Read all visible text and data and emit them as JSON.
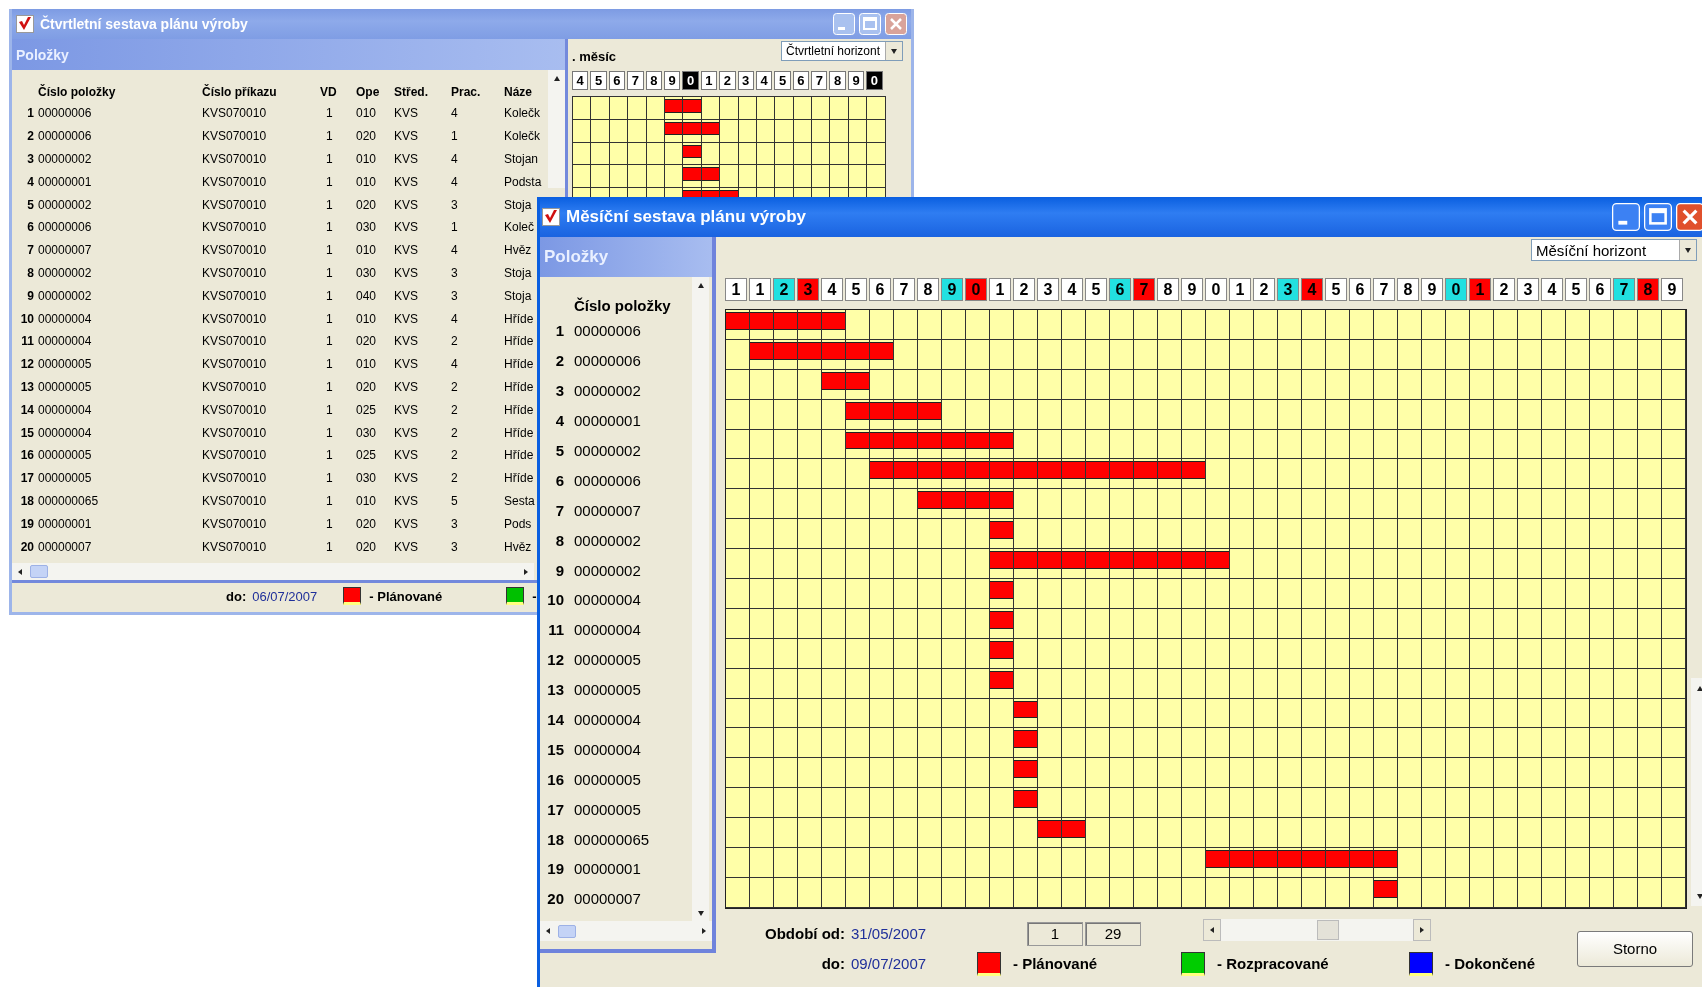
{
  "quarterly_window": {
    "title": "Čtvrtletní sestava plánu výroby",
    "active": false,
    "panel_title": "Položky",
    "columns": [
      "Číslo položky",
      "Číslo příkazu",
      "VD",
      "Ope",
      "Střed.",
      "Prac.",
      "Náze"
    ],
    "rows": [
      {
        "no": "1",
        "item": "00000006",
        "order": "KVS070010",
        "vd": "1",
        "op": "010",
        "center": "KVS",
        "workers": "4",
        "name": "Kolečk",
        "planned": [
          false,
          false,
          false,
          false,
          false,
          true,
          true,
          false,
          false,
          false,
          false,
          false,
          false,
          false,
          false,
          false,
          false
        ]
      },
      {
        "no": "2",
        "item": "00000006",
        "order": "KVS070010",
        "vd": "1",
        "op": "020",
        "center": "KVS",
        "workers": "1",
        "name": "Kolečk",
        "planned": [
          false,
          false,
          false,
          false,
          false,
          true,
          true,
          true,
          false,
          false,
          false,
          false,
          false,
          false,
          false,
          false,
          false
        ]
      },
      {
        "no": "3",
        "item": "00000002",
        "order": "KVS070010",
        "vd": "1",
        "op": "010",
        "center": "KVS",
        "workers": "4",
        "name": "Stojan",
        "planned": [
          false,
          false,
          false,
          false,
          false,
          false,
          true,
          false,
          false,
          false,
          false,
          false,
          false,
          false,
          false,
          false,
          false
        ]
      },
      {
        "no": "4",
        "item": "00000001",
        "order": "KVS070010",
        "vd": "1",
        "op": "010",
        "center": "KVS",
        "workers": "4",
        "name": "Podsta",
        "planned": [
          false,
          false,
          false,
          false,
          false,
          false,
          true,
          true,
          false,
          false,
          false,
          false,
          false,
          false,
          false,
          false,
          false
        ]
      },
      {
        "no": "5",
        "item": "00000002",
        "order": "KVS070010",
        "vd": "1",
        "op": "020",
        "center": "KVS",
        "workers": "3",
        "name": "Stoja",
        "planned": [
          false,
          false,
          false,
          false,
          false,
          false,
          true,
          true,
          true,
          false,
          false,
          false,
          false,
          false,
          false,
          false,
          false
        ]
      },
      {
        "no": "6",
        "item": "00000006",
        "order": "KVS070010",
        "vd": "1",
        "op": "030",
        "center": "KVS",
        "workers": "1",
        "name": "Koleč"
      },
      {
        "no": "7",
        "item": "00000007",
        "order": "KVS070010",
        "vd": "1",
        "op": "010",
        "center": "KVS",
        "workers": "4",
        "name": "Hvěz"
      },
      {
        "no": "8",
        "item": "00000002",
        "order": "KVS070010",
        "vd": "1",
        "op": "030",
        "center": "KVS",
        "workers": "3",
        "name": "Stoja"
      },
      {
        "no": "9",
        "item": "00000002",
        "order": "KVS070010",
        "vd": "1",
        "op": "040",
        "center": "KVS",
        "workers": "3",
        "name": "Stoja"
      },
      {
        "no": "10",
        "item": "00000004",
        "order": "KVS070010",
        "vd": "1",
        "op": "010",
        "center": "KVS",
        "workers": "4",
        "name": "Hříde"
      },
      {
        "no": "11",
        "item": "00000004",
        "order": "KVS070010",
        "vd": "1",
        "op": "020",
        "center": "KVS",
        "workers": "2",
        "name": "Hříde"
      },
      {
        "no": "12",
        "item": "00000005",
        "order": "KVS070010",
        "vd": "1",
        "op": "010",
        "center": "KVS",
        "workers": "4",
        "name": "Hříde"
      },
      {
        "no": "13",
        "item": "00000005",
        "order": "KVS070010",
        "vd": "1",
        "op": "020",
        "center": "KVS",
        "workers": "2",
        "name": "Hříde"
      },
      {
        "no": "14",
        "item": "00000004",
        "order": "KVS070010",
        "vd": "1",
        "op": "025",
        "center": "KVS",
        "workers": "2",
        "name": "Hříde"
      },
      {
        "no": "15",
        "item": "00000004",
        "order": "KVS070010",
        "vd": "1",
        "op": "030",
        "center": "KVS",
        "workers": "2",
        "name": "Hříde"
      },
      {
        "no": "16",
        "item": "00000005",
        "order": "KVS070010",
        "vd": "1",
        "op": "025",
        "center": "KVS",
        "workers": "2",
        "name": "Hříde"
      },
      {
        "no": "17",
        "item": "00000005",
        "order": "KVS070010",
        "vd": "1",
        "op": "030",
        "center": "KVS",
        "workers": "2",
        "name": "Hříde"
      },
      {
        "no": "18",
        "item": "000000065",
        "order": "KVS070010",
        "vd": "1",
        "op": "010",
        "center": "KVS",
        "workers": "5",
        "name": "Sesta"
      },
      {
        "no": "19",
        "item": "00000001",
        "order": "KVS070010",
        "vd": "1",
        "op": "020",
        "center": "KVS",
        "workers": "3",
        "name": "Pods"
      },
      {
        "no": "20",
        "item": "00000007",
        "order": "KVS070010",
        "vd": "1",
        "op": "020",
        "center": "KVS",
        "workers": "3",
        "name": "Hvěz"
      }
    ],
    "month_label": ". měsíc",
    "horizon": "Čtvrtletní horizont",
    "days": [
      {
        "label": "4",
        "kind": "weekday"
      },
      {
        "label": "5",
        "kind": "weekday"
      },
      {
        "label": "6",
        "kind": "weekday"
      },
      {
        "label": "7",
        "kind": "weekday"
      },
      {
        "label": "8",
        "kind": "weekday"
      },
      {
        "label": "9",
        "kind": "weekday"
      },
      {
        "label": "0",
        "kind": "marked"
      },
      {
        "label": "1",
        "kind": "weekday"
      },
      {
        "label": "2",
        "kind": "weekday"
      },
      {
        "label": "3",
        "kind": "weekday"
      },
      {
        "label": "4",
        "kind": "weekday"
      },
      {
        "label": "5",
        "kind": "weekday"
      },
      {
        "label": "6",
        "kind": "weekday"
      },
      {
        "label": "7",
        "kind": "weekday"
      },
      {
        "label": "8",
        "kind": "weekday"
      },
      {
        "label": "9",
        "kind": "weekday"
      },
      {
        "label": "0",
        "kind": "marked"
      }
    ],
    "to_label": "do:",
    "to_date": "06/07/2007",
    "legend": [
      {
        "label": "- Plánované",
        "color": "#ff0000"
      },
      {
        "label": "-",
        "color": "#00c000"
      }
    ]
  },
  "monthly_window": {
    "title": "Měsíční sestava plánu výroby",
    "active": true,
    "panel_title": "Položky",
    "column": "Číslo položky",
    "horizon": "Měsíční horizont",
    "days": [
      {
        "label": "1",
        "kind": "weekday"
      },
      {
        "label": "1",
        "kind": "weekday"
      },
      {
        "label": "2",
        "kind": "saturday"
      },
      {
        "label": "3",
        "kind": "sunday"
      },
      {
        "label": "4",
        "kind": "weekday"
      },
      {
        "label": "5",
        "kind": "weekday"
      },
      {
        "label": "6",
        "kind": "weekday"
      },
      {
        "label": "7",
        "kind": "weekday"
      },
      {
        "label": "8",
        "kind": "weekday"
      },
      {
        "label": "9",
        "kind": "saturday"
      },
      {
        "label": "0",
        "kind": "sunday"
      },
      {
        "label": "1",
        "kind": "weekday"
      },
      {
        "label": "2",
        "kind": "weekday"
      },
      {
        "label": "3",
        "kind": "weekday"
      },
      {
        "label": "4",
        "kind": "weekday"
      },
      {
        "label": "5",
        "kind": "weekday"
      },
      {
        "label": "6",
        "kind": "saturday"
      },
      {
        "label": "7",
        "kind": "sunday"
      },
      {
        "label": "8",
        "kind": "weekday"
      },
      {
        "label": "9",
        "kind": "weekday"
      },
      {
        "label": "0",
        "kind": "weekday"
      },
      {
        "label": "1",
        "kind": "weekday"
      },
      {
        "label": "2",
        "kind": "weekday"
      },
      {
        "label": "3",
        "kind": "saturday"
      },
      {
        "label": "4",
        "kind": "sunday"
      },
      {
        "label": "5",
        "kind": "weekday"
      },
      {
        "label": "6",
        "kind": "weekday"
      },
      {
        "label": "7",
        "kind": "weekday"
      },
      {
        "label": "8",
        "kind": "weekday"
      },
      {
        "label": "9",
        "kind": "weekday"
      },
      {
        "label": "0",
        "kind": "saturday"
      },
      {
        "label": "1",
        "kind": "sunday"
      },
      {
        "label": "2",
        "kind": "weekday"
      },
      {
        "label": "3",
        "kind": "weekday"
      },
      {
        "label": "4",
        "kind": "weekday"
      },
      {
        "label": "5",
        "kind": "weekday"
      },
      {
        "label": "6",
        "kind": "weekday"
      },
      {
        "label": "7",
        "kind": "saturday"
      },
      {
        "label": "8",
        "kind": "sunday"
      },
      {
        "label": "9",
        "kind": "weekday"
      }
    ],
    "rows": [
      {
        "no": "1",
        "item": "00000006",
        "planned": [
          true,
          true,
          true,
          true,
          true,
          false,
          false,
          false,
          false,
          false,
          false,
          false,
          false,
          false,
          false,
          false,
          false,
          false,
          false,
          false,
          false,
          false,
          false,
          false,
          false,
          false,
          false,
          false,
          false,
          false,
          false,
          false,
          false,
          false,
          false,
          false,
          false,
          false,
          false,
          false
        ]
      },
      {
        "no": "2",
        "item": "00000006",
        "planned": [
          false,
          true,
          true,
          true,
          true,
          true,
          true,
          false,
          false,
          false,
          false,
          false,
          false,
          false,
          false,
          false,
          false,
          false,
          false,
          false,
          false,
          false,
          false,
          false,
          false,
          false,
          false,
          false,
          false,
          false,
          false,
          false,
          false,
          false,
          false,
          false,
          false,
          false,
          false,
          false
        ]
      },
      {
        "no": "3",
        "item": "00000002",
        "planned": [
          false,
          false,
          false,
          false,
          true,
          true,
          false,
          false,
          false,
          false,
          false,
          false,
          false,
          false,
          false,
          false,
          false,
          false,
          false,
          false,
          false,
          false,
          false,
          false,
          false,
          false,
          false,
          false,
          false,
          false,
          false,
          false,
          false,
          false,
          false,
          false,
          false,
          false,
          false,
          false
        ]
      },
      {
        "no": "4",
        "item": "00000001",
        "planned": [
          false,
          false,
          false,
          false,
          false,
          true,
          true,
          true,
          true,
          false,
          false,
          false,
          false,
          false,
          false,
          false,
          false,
          false,
          false,
          false,
          false,
          false,
          false,
          false,
          false,
          false,
          false,
          false,
          false,
          false,
          false,
          false,
          false,
          false,
          false,
          false,
          false,
          false,
          false,
          false
        ]
      },
      {
        "no": "5",
        "item": "00000002",
        "planned": [
          false,
          false,
          false,
          false,
          false,
          true,
          true,
          true,
          true,
          true,
          true,
          true,
          false,
          false,
          false,
          false,
          false,
          false,
          false,
          false,
          false,
          false,
          false,
          false,
          false,
          false,
          false,
          false,
          false,
          false,
          false,
          false,
          false,
          false,
          false,
          false,
          false,
          false,
          false,
          false
        ]
      },
      {
        "no": "6",
        "item": "00000006",
        "planned": [
          false,
          false,
          false,
          false,
          false,
          false,
          true,
          true,
          true,
          true,
          true,
          true,
          true,
          true,
          true,
          true,
          true,
          true,
          true,
          true,
          false,
          false,
          false,
          false,
          false,
          false,
          false,
          false,
          false,
          false,
          false,
          false,
          false,
          false,
          false,
          false,
          false,
          false,
          false,
          false
        ]
      },
      {
        "no": "7",
        "item": "00000007",
        "planned": [
          false,
          false,
          false,
          false,
          false,
          false,
          false,
          false,
          true,
          true,
          true,
          true,
          false,
          false,
          false,
          false,
          false,
          false,
          false,
          false,
          false,
          false,
          false,
          false,
          false,
          false,
          false,
          false,
          false,
          false,
          false,
          false,
          false,
          false,
          false,
          false,
          false,
          false,
          false,
          false
        ]
      },
      {
        "no": "8",
        "item": "00000002",
        "planned": [
          false,
          false,
          false,
          false,
          false,
          false,
          false,
          false,
          false,
          false,
          false,
          true,
          false,
          false,
          false,
          false,
          false,
          false,
          false,
          false,
          false,
          false,
          false,
          false,
          false,
          false,
          false,
          false,
          false,
          false,
          false,
          false,
          false,
          false,
          false,
          false,
          false,
          false,
          false,
          false
        ]
      },
      {
        "no": "9",
        "item": "00000002",
        "planned": [
          false,
          false,
          false,
          false,
          false,
          false,
          false,
          false,
          false,
          false,
          false,
          true,
          true,
          true,
          true,
          true,
          true,
          true,
          true,
          true,
          true,
          false,
          false,
          false,
          false,
          false,
          false,
          false,
          false,
          false,
          false,
          false,
          false,
          false,
          false,
          false,
          false,
          false,
          false,
          false
        ]
      },
      {
        "no": "10",
        "item": "00000004",
        "planned": [
          false,
          false,
          false,
          false,
          false,
          false,
          false,
          false,
          false,
          false,
          false,
          true,
          false,
          false,
          false,
          false,
          false,
          false,
          false,
          false,
          false,
          false,
          false,
          false,
          false,
          false,
          false,
          false,
          false,
          false,
          false,
          false,
          false,
          false,
          false,
          false,
          false,
          false,
          false,
          false
        ]
      },
      {
        "no": "11",
        "item": "00000004",
        "planned": [
          false,
          false,
          false,
          false,
          false,
          false,
          false,
          false,
          false,
          false,
          false,
          true,
          false,
          false,
          false,
          false,
          false,
          false,
          false,
          false,
          false,
          false,
          false,
          false,
          false,
          false,
          false,
          false,
          false,
          false,
          false,
          false,
          false,
          false,
          false,
          false,
          false,
          false,
          false,
          false
        ]
      },
      {
        "no": "12",
        "item": "00000005",
        "planned": [
          false,
          false,
          false,
          false,
          false,
          false,
          false,
          false,
          false,
          false,
          false,
          true,
          false,
          false,
          false,
          false,
          false,
          false,
          false,
          false,
          false,
          false,
          false,
          false,
          false,
          false,
          false,
          false,
          false,
          false,
          false,
          false,
          false,
          false,
          false,
          false,
          false,
          false,
          false,
          false
        ]
      },
      {
        "no": "13",
        "item": "00000005",
        "planned": [
          false,
          false,
          false,
          false,
          false,
          false,
          false,
          false,
          false,
          false,
          false,
          true,
          false,
          false,
          false,
          false,
          false,
          false,
          false,
          false,
          false,
          false,
          false,
          false,
          false,
          false,
          false,
          false,
          false,
          false,
          false,
          false,
          false,
          false,
          false,
          false,
          false,
          false,
          false,
          false
        ]
      },
      {
        "no": "14",
        "item": "00000004",
        "planned": [
          false,
          false,
          false,
          false,
          false,
          false,
          false,
          false,
          false,
          false,
          false,
          false,
          true,
          false,
          false,
          false,
          false,
          false,
          false,
          false,
          false,
          false,
          false,
          false,
          false,
          false,
          false,
          false,
          false,
          false,
          false,
          false,
          false,
          false,
          false,
          false,
          false,
          false,
          false,
          false
        ]
      },
      {
        "no": "15",
        "item": "00000004",
        "planned": [
          false,
          false,
          false,
          false,
          false,
          false,
          false,
          false,
          false,
          false,
          false,
          false,
          true,
          false,
          false,
          false,
          false,
          false,
          false,
          false,
          false,
          false,
          false,
          false,
          false,
          false,
          false,
          false,
          false,
          false,
          false,
          false,
          false,
          false,
          false,
          false,
          false,
          false,
          false,
          false
        ]
      },
      {
        "no": "16",
        "item": "00000005",
        "planned": [
          false,
          false,
          false,
          false,
          false,
          false,
          false,
          false,
          false,
          false,
          false,
          false,
          true,
          false,
          false,
          false,
          false,
          false,
          false,
          false,
          false,
          false,
          false,
          false,
          false,
          false,
          false,
          false,
          false,
          false,
          false,
          false,
          false,
          false,
          false,
          false,
          false,
          false,
          false,
          false
        ]
      },
      {
        "no": "17",
        "item": "00000005",
        "planned": [
          false,
          false,
          false,
          false,
          false,
          false,
          false,
          false,
          false,
          false,
          false,
          false,
          true,
          false,
          false,
          false,
          false,
          false,
          false,
          false,
          false,
          false,
          false,
          false,
          false,
          false,
          false,
          false,
          false,
          false,
          false,
          false,
          false,
          false,
          false,
          false,
          false,
          false,
          false,
          false
        ]
      },
      {
        "no": "18",
        "item": "000000065",
        "planned": [
          false,
          false,
          false,
          false,
          false,
          false,
          false,
          false,
          false,
          false,
          false,
          false,
          false,
          true,
          true,
          false,
          false,
          false,
          false,
          false,
          false,
          false,
          false,
          false,
          false,
          false,
          false,
          false,
          false,
          false,
          false,
          false,
          false,
          false,
          false,
          false,
          false,
          false,
          false,
          false
        ]
      },
      {
        "no": "19",
        "item": "00000001",
        "planned": [
          false,
          false,
          false,
          false,
          false,
          false,
          false,
          false,
          false,
          false,
          false,
          false,
          false,
          false,
          false,
          false,
          false,
          false,
          false,
          false,
          true,
          true,
          true,
          true,
          true,
          true,
          true,
          true,
          false,
          false,
          false,
          false,
          false,
          false,
          false,
          false,
          false,
          false,
          false,
          false
        ]
      },
      {
        "no": "20",
        "item": "00000007",
        "planned": [
          false,
          false,
          false,
          false,
          false,
          false,
          false,
          false,
          false,
          false,
          false,
          false,
          false,
          false,
          false,
          false,
          false,
          false,
          false,
          false,
          false,
          false,
          false,
          false,
          false,
          false,
          false,
          true,
          false,
          false,
          false,
          false,
          false,
          false,
          false,
          false,
          false,
          false,
          false,
          false
        ]
      }
    ],
    "period": {
      "from_label": "Období od:",
      "from_date": "31/05/2007",
      "to_label": "do:",
      "to_date": "09/07/2007"
    },
    "range_fields": [
      "1",
      "29"
    ],
    "legend": [
      {
        "label": "- Plánované",
        "color": "#ff0000"
      },
      {
        "label": "- Rozpracované",
        "color": "#00cc00"
      },
      {
        "label": "- Dokončené",
        "color": "#0000ff"
      }
    ],
    "buttons": [
      "Storno"
    ]
  }
}
